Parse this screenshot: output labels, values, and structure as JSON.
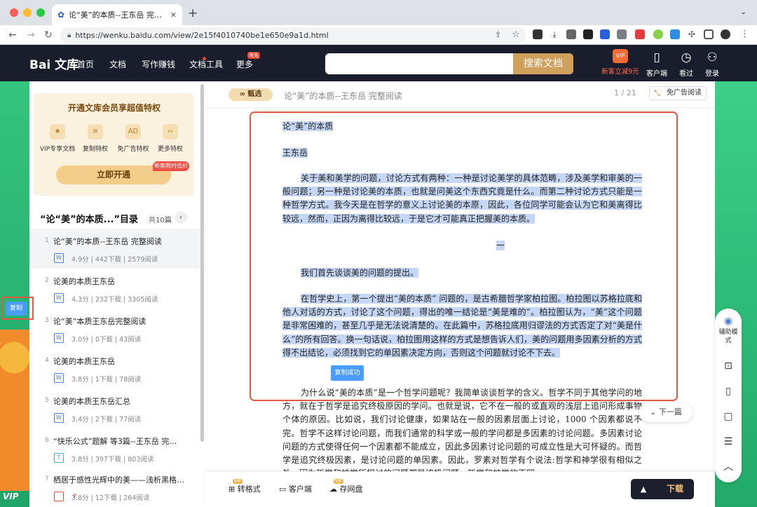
{
  "browser": {
    "tab_title": "论“美”的本质--王东岳 完整阅",
    "url": "https://wenku.baidu.com/view/2e15f4010740be1e650e9a1d.html"
  },
  "site": {
    "logo": "Bai 文库",
    "nav": [
      "首页",
      "文档",
      "写作赚钱",
      "文档工具",
      "更多"
    ],
    "nav_badge": "限免",
    "search_button": "搜索文档",
    "search_placeholder": "",
    "promo_label": "新客立减9元",
    "header_icons": [
      "客户端",
      "看过",
      "登录"
    ]
  },
  "sidebar": {
    "promo_title": "开通文库会员享超值特权",
    "features": [
      "VIP专享文档",
      "复制特权",
      "免广告特权",
      "更多特权"
    ],
    "open_button": "立即开通",
    "new_tag": "新客限时低价",
    "toc_title": "“论“美”的本质...”目录",
    "toc_count": "共10篇",
    "items": [
      {
        "num": "1",
        "title": "论“美”的本质--王东岳 完整阅读",
        "badge": "W",
        "score": "4.9分",
        "downloads": "442下载",
        "reads": "2579阅读"
      },
      {
        "num": "2",
        "title": "论美的本质王东岳",
        "badge": "W",
        "score": "4.3分",
        "downloads": "232下载",
        "reads": "3305阅读"
      },
      {
        "num": "3",
        "title": "论“美”本质王东岳完整阅读",
        "badge": "W",
        "score": "3.0分",
        "downloads": "0下载",
        "reads": "43阅读"
      },
      {
        "num": "4",
        "title": "论美的本质王东岳",
        "badge": "W",
        "score": "3.8分",
        "downloads": "1下载",
        "reads": "78阅读"
      },
      {
        "num": "5",
        "title": "论美的本质王东岳汇总",
        "badge": "W",
        "score": "3.4分",
        "downloads": "2下载",
        "reads": "77阅读"
      },
      {
        "num": "6",
        "title": "“快乐公式”题解 等3篇--王东岳 完…",
        "badge": "T",
        "score": "3.8分",
        "downloads": "397下载",
        "reads": "803阅读"
      },
      {
        "num": "7",
        "title": "栖居于感性光辉中的美——浅析黑格…",
        "badge": "P",
        "score": "3.8分",
        "downloads": "12下载",
        "reads": "264阅读"
      }
    ]
  },
  "doc": {
    "zhenxuan": "甄选",
    "title": "论“美”的本质--王东岳 完整阅读",
    "page": "1 / 21",
    "noad": "免广告阅读",
    "heading": "论“美”的本质",
    "author": "王东岳",
    "p1_lines": [
      "关于美和美学的问题，讨论方式有两种：一种是讨论美学的具体范畴，涉及美学和审美",
      "的一般问题；另一种是讨论美的本质，也就是问美这个东西究竟是什么。而第二种讨论方式",
      "只能是一种哲学方式。我今天是在哲学的意义上讨论美的本原，因此，各位同学可能会认为",
      "它和美离得比较远，然而，正因为离得比较远，于是它才可能真正把握美的本质。"
    ],
    "section": "一",
    "p2": "我们首先谈谈美的问题的提出。",
    "p3_lines": [
      "在哲学史上，第一个提出“美的本质” 问题的，是古希腊哲学家柏拉图。柏拉图以苏格",
      "拉底和他人对话的方式，讨论了这个问题，得出的唯一结论是“美是难的”。柏拉图认为，“美”",
      "这个问题是非常困难的，甚至几乎是无法说清楚的。在此篇中，苏格拉底用归谬法的方式否",
      "定了对“美是什么”的所有回答。换一句话说，柏拉图用这样的方式是想告诉人们，美的问",
      "题用多因素分析的方式得不出结论，必须找到它的单因素决定方向，否则这个问题就讨论不",
      "下去。"
    ],
    "p4_lines": [
      "为什么说“美的本质”是一个哲学问题呢？我简单谈谈哲学的含义。哲学不同于其他学",
      "问的地方，就在于哲学是追究终极原因的学问。也就是说，它不在一般的或直观的浅层上追",
      "问形成事物个体的原因。比如说，我们讨论健康，如果站在一般的因素层面上讨论，1000 个",
      "因素都说不完。哲学不这样讨论问题，而我们通常的科学或一般的学问都是多因素的讨论问",
      "题。多因素讨论问题的方式使得任何一个因素都不能成立，因此多因素讨论问题的可成立性",
      "是大可怀疑的。而哲学是追究终极因素，是讨论问题的单因素。因此，罗素对哲学有个说法:",
      "哲学和神学很有相似之处，因为哲学和神学所探讨的问题都是终极问题，哲学和神学的不同"
    ],
    "copy_success": "复制成功",
    "next_page": "下一篇"
  },
  "bottom": {
    "items": [
      "转格式",
      "客户端",
      "存网盘"
    ],
    "download": "下载"
  },
  "right_tools": {
    "assist": "辅助模式"
  },
  "left_edge": {
    "copy": "复制",
    "vip": "VIP"
  },
  "colors": {
    "header_bg": "#1a1d2c",
    "gold": "#cfa15d",
    "selection": "#c5d7f5",
    "highlight_border": "#e25a43"
  }
}
